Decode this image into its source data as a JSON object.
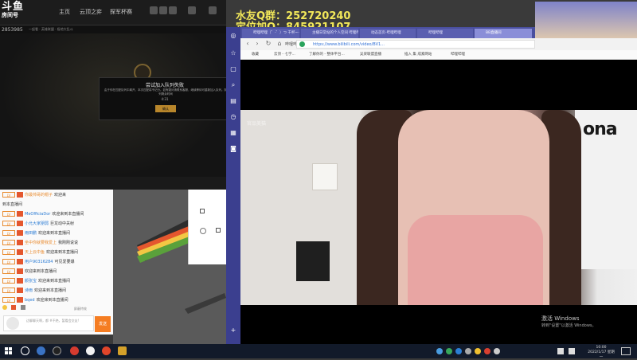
{
  "game": {
    "logo_big": "斗鱼",
    "logo_small": "房间号",
    "room_id": "2853985",
    "nav": [
      "主页",
      "云顶之弈",
      "探军杯赛"
    ],
    "sub_info": "一起看 · 英雄联盟 · 极地大乱斗",
    "toolbar_labels": [
      "",
      "",
      "",
      "",
      "",
      "",
      "",
      ""
    ],
    "dialog": {
      "title": "尝试加入队列失败",
      "body": "由于你在匹配队列中离开，本次匹配将不记分。如有疑问请联系客服，继续等待可重新加入队列。队列剩余时间",
      "time": "4:31",
      "button": "确认"
    }
  },
  "chat": {
    "rows": [
      {
        "level": "LV",
        "user": "你最帅哥的帽子",
        "msg": "欢迎来",
        "user_color": "orange"
      },
      {
        "level": "",
        "user": "",
        "msg": "到本直播间",
        "user_color": ""
      },
      {
        "level": "LV",
        "user": "MeOfficiaDor",
        "msg": "欢迎来到本直播间",
        "user_color": "blue"
      },
      {
        "level": "LV",
        "user": "小允大家朋弱",
        "msg": "巨龙动中关射",
        "user_color": "blue"
      },
      {
        "level": "LV",
        "user": "雨田鹏",
        "msg": "欢迎来到本直播间",
        "user_color": "blue"
      },
      {
        "level": "LV",
        "user": "坐中你就要我爱上",
        "msg": "我刚刚说说",
        "user_color": "orange"
      },
      {
        "level": "LV",
        "user": "天上云中鱼",
        "msg": "欢迎来到本直播间",
        "user_color": "orange"
      },
      {
        "level": "LV",
        "user": "用户90316284",
        "msg": "可见爱要爆",
        "user_color": "blue"
      },
      {
        "level": "LV",
        "user": "",
        "msg": "欢迎来到本直播间",
        "user_color": "blue"
      },
      {
        "level": "LV",
        "user": "颜张宝",
        "msg": "欢迎来到本直播间",
        "user_color": "blue"
      },
      {
        "level": "LV",
        "user": "诗雨",
        "msg": "欢迎来到本直播间",
        "user_color": "blue"
      },
      {
        "level": "LV",
        "user": "bqed",
        "msg": "欢迎来到本直播间",
        "user_color": "blue"
      }
    ],
    "tools_label": "屏蔽特效",
    "input_placeholder": "边聊聊天啊，都 #不绝，暂看会交友!",
    "send_label": "发送"
  },
  "overlay": {
    "line1": "水友Q群：252720240",
    "line2": "定位加Q：845921107"
  },
  "browser": {
    "tabs": [
      "哔哩哔哩（゜-゜）つ 干杯~-bili...",
      "主播日常站的个人空间 哔哩哔哩...",
      "动态首页-哔哩哔哩",
      "哔哩哔哩",
      "BB直播间"
    ],
    "url": "https://www.bilibili.com/video/BV1...",
    "url_title": "哔哩哔哩播放器",
    "bookmarks": [
      "收藏",
      "云顶 - 七学...",
      "了解你的 - 整体平台...",
      "吴梁联盟直播",
      "插入 集 成素网站",
      "哔哩哔哩"
    ],
    "video_watermark": "官品美猫",
    "shirt_text": "ona"
  },
  "activate": {
    "title": "激活 Windows",
    "subtitle": "转到\"设置\"以激活 Windows。"
  },
  "taskbar": {
    "time": "10:00",
    "date": "2022/1/17 星期一"
  }
}
